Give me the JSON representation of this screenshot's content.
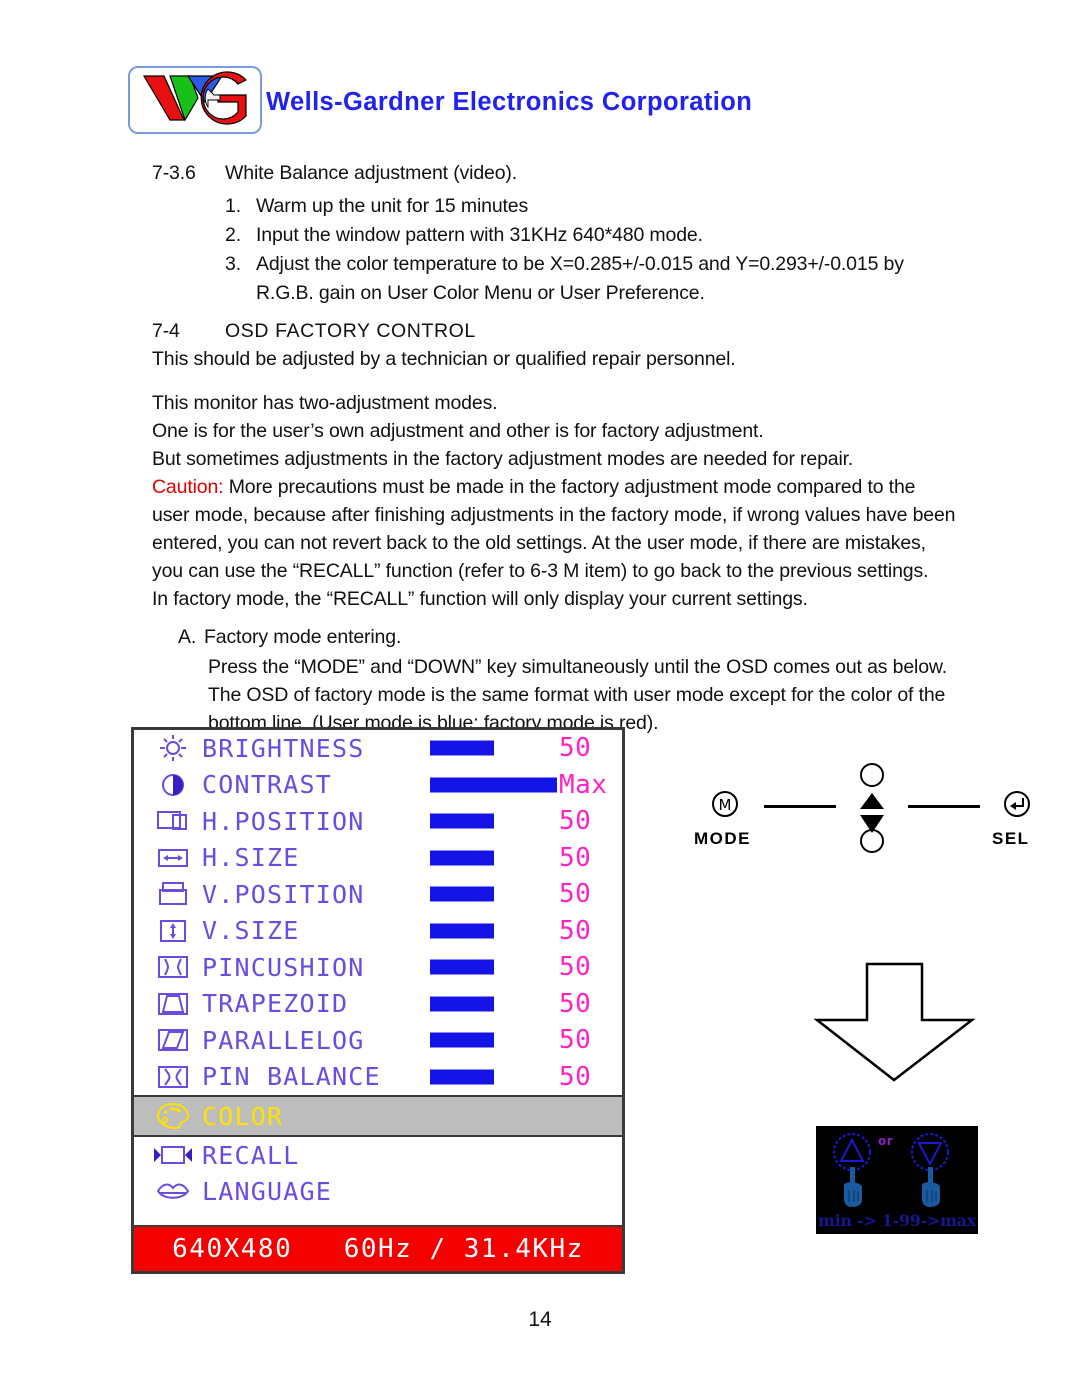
{
  "header": {
    "company": "Wells-Gardner Electronics Corporation",
    "logo_alt": "WG"
  },
  "sections": {
    "s736_number": "7-3.6",
    "s736_title": "White Balance adjustment (video).",
    "s736_items": [
      {
        "num": "1.",
        "text": "Warm up the unit for 15 minutes"
      },
      {
        "num": "2.",
        "text": "Input the window pattern with 31KHz 640*480 mode."
      },
      {
        "num": "3.",
        "text": "Adjust the color temperature to be X=0.285+/-0.015 and Y=0.293+/-0.015 by"
      },
      {
        "num": "",
        "text": "R.G.B. gain on User Color Menu or User Preference."
      }
    ],
    "s74_number": "7-4",
    "s74_title": "OSD FACTORY CONTROL",
    "s74_lines": [
      "This should be adjusted by a technician or qualified repair personnel.",
      "This monitor has two-adjustment modes.",
      "One is for the user’s own adjustment and other is for factory adjustment.",
      "But sometimes adjustments in the factory adjustment modes are needed for repair."
    ],
    "caution_label": "Caution:",
    "caution_lines": [
      " More precautions must be made in the factory adjustment mode compared to the",
      "user mode, because after finishing adjustments in the factory mode, if wrong values have been",
      "entered, you can not revert back to the old settings.  At the user mode, if there are mistakes,",
      "you can use the “RECALL” function (refer to 6-3 M item) to go back to the previous settings.",
      "In factory mode, the “RECALL” function will only display your current settings."
    ],
    "item_a_label": "A.",
    "item_a_title": "Factory mode entering.",
    "item_a_lines": [
      "Press the “MODE” and “DOWN” key simultaneously until the OSD comes out as below.",
      "The OSD of factory mode is the same format with user mode except for the color of the",
      "bottom line. (User mode is blue; factory mode is red)."
    ]
  },
  "osd": {
    "rows": [
      {
        "icon": "brightness-icon",
        "label": "BRIGHTNESS",
        "value": "50",
        "bar": 64,
        "highlight": false
      },
      {
        "icon": "contrast-icon",
        "label": "CONTRAST",
        "value": "Max",
        "bar": 127,
        "highlight": false
      },
      {
        "icon": "h-position-icon",
        "label": "H.POSITION",
        "value": "50",
        "bar": 64,
        "highlight": false
      },
      {
        "icon": "h-size-icon",
        "label": "H.SIZE",
        "value": "50",
        "bar": 64,
        "highlight": false
      },
      {
        "icon": "v-position-icon",
        "label": "V.POSITION",
        "value": "50",
        "bar": 64,
        "highlight": false
      },
      {
        "icon": "v-size-icon",
        "label": "V.SIZE",
        "value": "50",
        "bar": 64,
        "highlight": false
      },
      {
        "icon": "pincushion-icon",
        "label": "PINCUSHION",
        "value": "50",
        "bar": 64,
        "highlight": false
      },
      {
        "icon": "trapezoid-icon",
        "label": "TRAPEZOID",
        "value": "50",
        "bar": 64,
        "highlight": false
      },
      {
        "icon": "parallelog-icon",
        "label": "PARALLELOG",
        "value": "50",
        "bar": 64,
        "highlight": false
      },
      {
        "icon": "pin-balance-icon",
        "label": "PIN BALANCE",
        "value": "50",
        "bar": 64,
        "highlight": false
      },
      {
        "icon": "color-palette-icon",
        "label": "COLOR",
        "value": "",
        "bar": 0,
        "highlight": true
      },
      {
        "icon": "recall-icon",
        "label": "RECALL",
        "value": "",
        "bar": 0,
        "highlight": false
      },
      {
        "icon": "language-icon",
        "label": "LANGUAGE",
        "value": "",
        "bar": 0,
        "highlight": false
      }
    ],
    "footer": "640X480   60Hz / 31.4KHz",
    "colors": {
      "label": "#6a4ce0",
      "value": "#ff22c4",
      "bar": "#1414e6",
      "highlight_bg": "#bdbdbd",
      "highlight_text": "#ffe100",
      "footer_bg": "#f50000",
      "footer_text": "#ffffff"
    }
  },
  "buttons": {
    "mode_label": "MODE",
    "mode_glyph": "M",
    "sel_label": "SEL",
    "sel_glyph": "↵",
    "up_icon": "up-triangle-icon",
    "down_icon": "down-triangle-icon"
  },
  "flow": {
    "arrow_icon": "down-arrow-icon"
  },
  "mini_osd": {
    "or_text": "or",
    "caption": "min -> 1-99->max",
    "up_icon": "circled-up-triangle-icon",
    "down_icon": "circled-down-triangle-icon",
    "hand_icon": "pointing-hand-icon",
    "bg": "#000000",
    "accent": "#16168f"
  },
  "page": {
    "number": "14"
  }
}
